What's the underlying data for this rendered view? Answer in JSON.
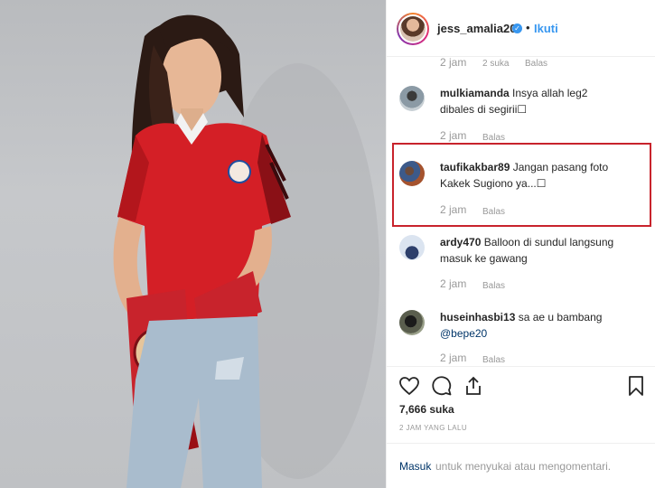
{
  "post": {
    "username": "jess_amalia20",
    "follow_label": "Ikuti",
    "dot": "•"
  },
  "comments": [
    {
      "time": "2 jam",
      "likes": "2 suka",
      "reply": "Balas"
    },
    {
      "user": "mulkiamanda",
      "text": "Insya allah leg2 dibales di segirii☐",
      "time": "2 jam",
      "reply": "Balas"
    },
    {
      "user": "taufikakbar89",
      "text": "Jangan pasang foto Kakek Sugiono ya...☐",
      "time": "2 jam",
      "reply": "Balas"
    },
    {
      "user": "ardy470",
      "text": "Balloon di sundul langsung masuk ke gawang",
      "time": "2 jam",
      "reply": "Balas"
    },
    {
      "user": "huseinhasbi13",
      "text": "sa ae u bambang",
      "mention": "@bepe20",
      "time": "2 jam",
      "reply": "Balas"
    }
  ],
  "actions": {
    "like_icon": "heart-icon",
    "comment_icon": "comment-icon",
    "share_icon": "share-icon",
    "save_icon": "bookmark-icon",
    "likes_count": "7,666 suka",
    "posted": "2 JAM YANG LALU"
  },
  "login": {
    "link": "Masuk",
    "text": "untuk menyukai atau mengomentari."
  },
  "colors": {
    "accent": "#3897f0",
    "highlight": "#c8232c",
    "jersey": "#d41f26"
  }
}
